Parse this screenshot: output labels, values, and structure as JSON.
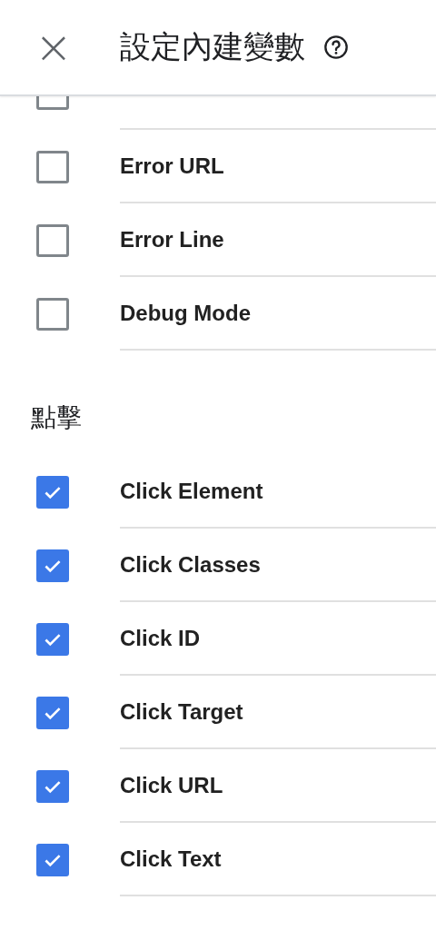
{
  "header": {
    "close": "×",
    "title": "設定內建變數"
  },
  "sections": [
    {
      "items": [
        {
          "checked": false
        },
        {
          "label": "Error URL",
          "checked": false
        },
        {
          "label": "Error Line",
          "checked": false
        },
        {
          "label": "Debug Mode",
          "checked": false
        }
      ]
    },
    {
      "heading": "點擊",
      "items": [
        {
          "label": "Click Element",
          "checked": true
        },
        {
          "label": "Click Classes",
          "checked": true
        },
        {
          "label": "Click ID",
          "checked": true
        },
        {
          "label": "Click Target",
          "checked": true
        },
        {
          "label": "Click URL",
          "checked": true
        },
        {
          "label": "Click Text",
          "checked": true
        }
      ]
    }
  ]
}
